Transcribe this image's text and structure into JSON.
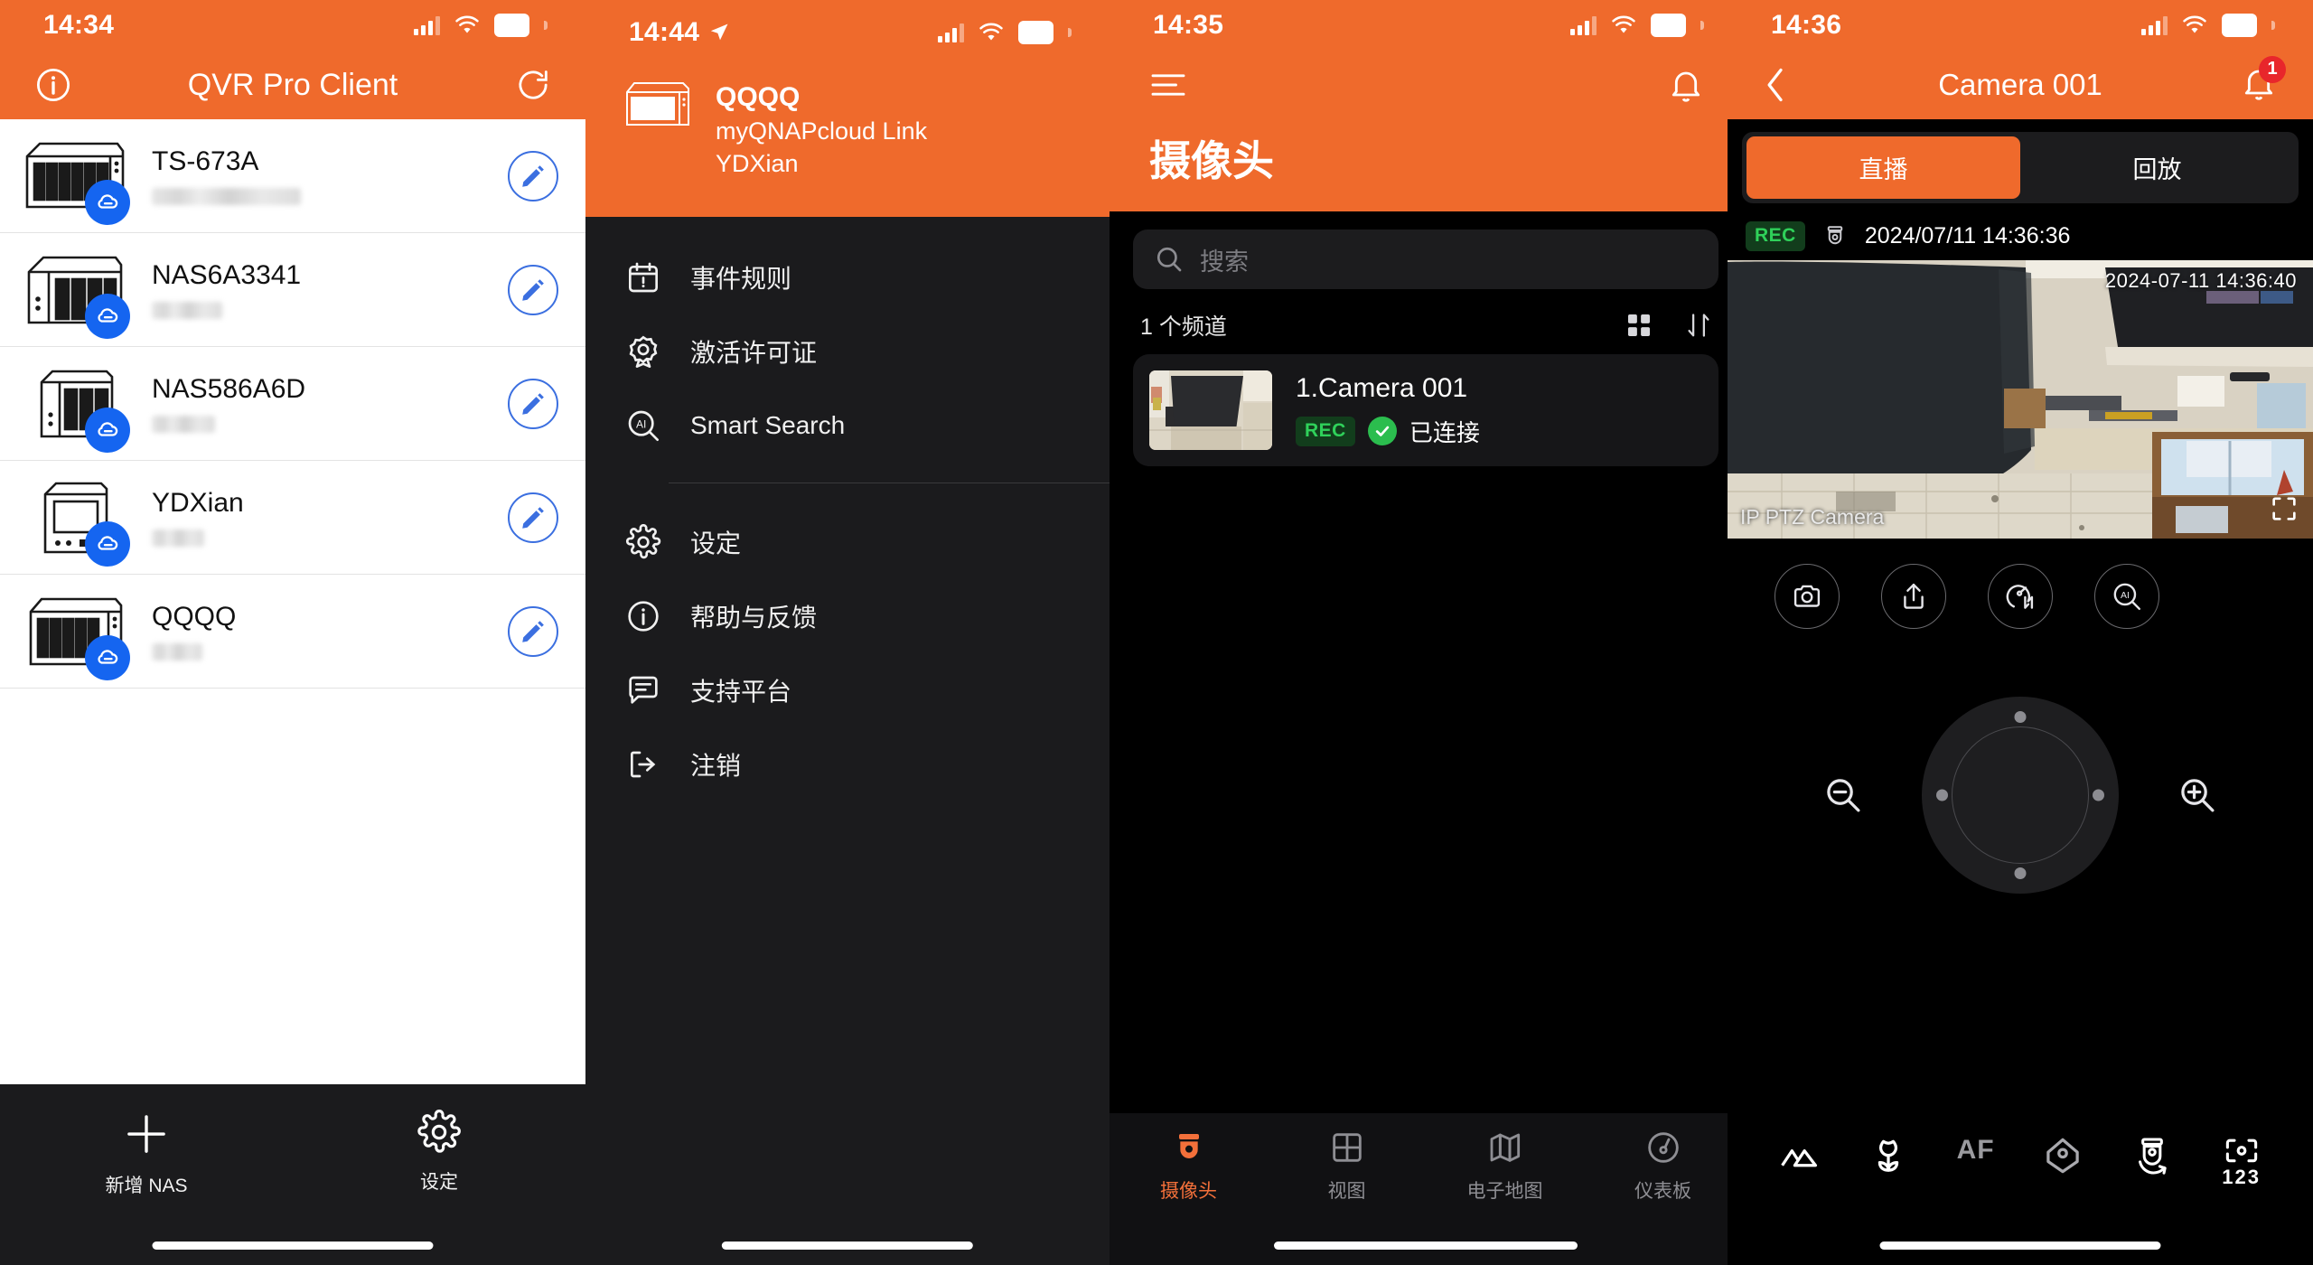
{
  "panels": {
    "nas_list": {
      "status": {
        "time": "14:34",
        "battery": "81"
      },
      "navbar": {
        "title": "QVR Pro Client",
        "info_icon": "info-circle-icon",
        "refresh_icon": "refresh-icon"
      },
      "rows": [
        {
          "name": "TS-673A",
          "detail_masked": true
        },
        {
          "name": "NAS6A3341",
          "detail_masked": true
        },
        {
          "name": "NAS586A6D",
          "detail_masked": true
        },
        {
          "name": "YDXian",
          "detail_masked": true
        },
        {
          "name": "QQQQ",
          "detail_masked": true
        }
      ],
      "bottom_tabs": [
        {
          "label": "新增 NAS",
          "icon": "plus-icon"
        },
        {
          "label": "设定",
          "icon": "gear-icon"
        }
      ]
    },
    "menu": {
      "status": {
        "time": "14:44",
        "battery": "76"
      },
      "account": {
        "name": "QQQQ",
        "connection": "myQNAPcloud Link",
        "user": "YDXian",
        "icon": "nas-device-icon"
      },
      "items": [
        {
          "label": "事件规则",
          "icon": "calendar-alert-icon"
        },
        {
          "label": "激活许可证",
          "icon": "license-badge-icon"
        },
        {
          "label": "Smart Search",
          "icon": "ai-search-icon"
        },
        {
          "label": "设定",
          "icon": "gear-icon"
        },
        {
          "label": "帮助与反馈",
          "icon": "info-circle-icon"
        },
        {
          "label": "支持平台",
          "icon": "chat-lines-icon"
        },
        {
          "label": "注销",
          "icon": "logout-icon"
        }
      ],
      "separator_after_index": 2
    },
    "cameras": {
      "status": {
        "time": "14:35",
        "battery": "80"
      },
      "navbar": {
        "menu_icon": "hamburger-icon",
        "bell_icon": "bell-icon"
      },
      "title": "摄像头",
      "search": {
        "placeholder": "搜索",
        "value": "",
        "icon": "search-icon"
      },
      "channel_count_label": "1 个频道",
      "tools": [
        {
          "icon": "grid-view-icon"
        },
        {
          "icon": "sort-icon"
        }
      ],
      "camera_items": [
        {
          "name": "1.Camera 001",
          "rec_badge": "REC",
          "status": "已连接",
          "status_ok": true
        }
      ],
      "bottom_tabs": [
        {
          "label": "摄像头",
          "icon": "cctv-camera-icon",
          "active": true
        },
        {
          "label": "视图",
          "icon": "grid-icon",
          "active": false
        },
        {
          "label": "电子地图",
          "icon": "map-icon",
          "active": false
        },
        {
          "label": "仪表板",
          "icon": "gauge-icon",
          "active": false
        }
      ]
    },
    "camera_detail": {
      "status": {
        "time": "14:36",
        "battery": "80"
      },
      "navbar": {
        "back_icon": "chevron-left-icon",
        "title": "Camera 001",
        "bell_icon": "bell-icon",
        "bell_badge": "1"
      },
      "segments": [
        {
          "label": "直播",
          "active": true
        },
        {
          "label": "回放",
          "active": false
        }
      ],
      "rec_bar": {
        "badge": "REC",
        "icon": "cctv-camera-icon",
        "timestamp": "2024/07/11 14:36:36"
      },
      "video": {
        "overlay_timestamp": "2024-07-11 14:36:40",
        "overlay_label": "IP PTZ Camera",
        "fullscreen_icon": "fullscreen-icon"
      },
      "actions": [
        {
          "icon": "snapshot-camera-icon"
        },
        {
          "icon": "share-icon"
        },
        {
          "icon": "stream-quality-icon"
        },
        {
          "icon": "ai-search-icon"
        }
      ],
      "ptz": {
        "zoom_out_icon": "zoom-out-icon",
        "zoom_in_icon": "zoom-in-icon",
        "joystick_icon": "ptz-joystick-icon"
      },
      "bottom_tools": [
        {
          "icon": "focus-far-mountains-icon"
        },
        {
          "icon": "focus-near-flower-icon"
        },
        {
          "label": "AF",
          "icon": "autofocus-text-icon"
        },
        {
          "icon": "home-preset-icon"
        },
        {
          "icon": "auto-pan-icon"
        },
        {
          "icon": "preset-positions-icon",
          "label": "123"
        }
      ]
    }
  },
  "colors": {
    "brand_orange": "#ef6a2c",
    "accent_blue": "#1565f0",
    "status_green": "#2bbd4e",
    "rec_green": "#2fd15a",
    "badge_red": "#e8262b",
    "dark_bg": "#1b1b1d"
  }
}
